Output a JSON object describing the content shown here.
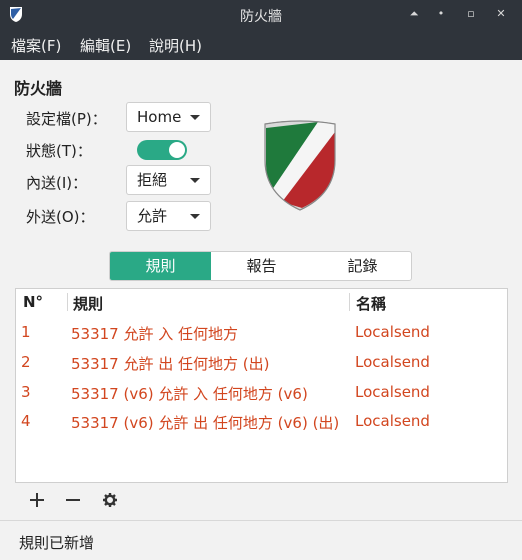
{
  "window": {
    "title": "防火牆"
  },
  "menubar": {
    "items": [
      "檔案(F)",
      "編輯(E)",
      "說明(H)"
    ]
  },
  "section": {
    "title": "防火牆"
  },
  "settings": {
    "profile": {
      "label": "設定檔(P)：",
      "value": "Home"
    },
    "status": {
      "label": "狀態(T)：",
      "enabled": true
    },
    "incoming": {
      "label": "內送(I)：",
      "value": "拒絕"
    },
    "outgoing": {
      "label": "外送(O)：",
      "value": "允許"
    }
  },
  "tabs": {
    "items": [
      "規則",
      "報告",
      "記錄"
    ],
    "active": 0
  },
  "rules": {
    "columns": [
      "N°",
      "規則",
      "名稱"
    ],
    "rows": [
      {
        "n": "1",
        "rule": "53317 允許 入 任何地方",
        "name": "Localsend"
      },
      {
        "n": "2",
        "rule": "53317 允許 出 任何地方 (出)",
        "name": "Localsend"
      },
      {
        "n": "3",
        "rule": "53317 (v6) 允許 入 任何地方 (v6)",
        "name": "Localsend"
      },
      {
        "n": "4",
        "rule": "53317 (v6) 允許 出 任何地方 (v6) (出)",
        "name": "Localsend"
      }
    ]
  },
  "statusbar": {
    "text": "規則已新增"
  },
  "colors": {
    "accent": "#2aa986",
    "rule_text": "#d2461f",
    "titlebar": "#2f343b"
  }
}
